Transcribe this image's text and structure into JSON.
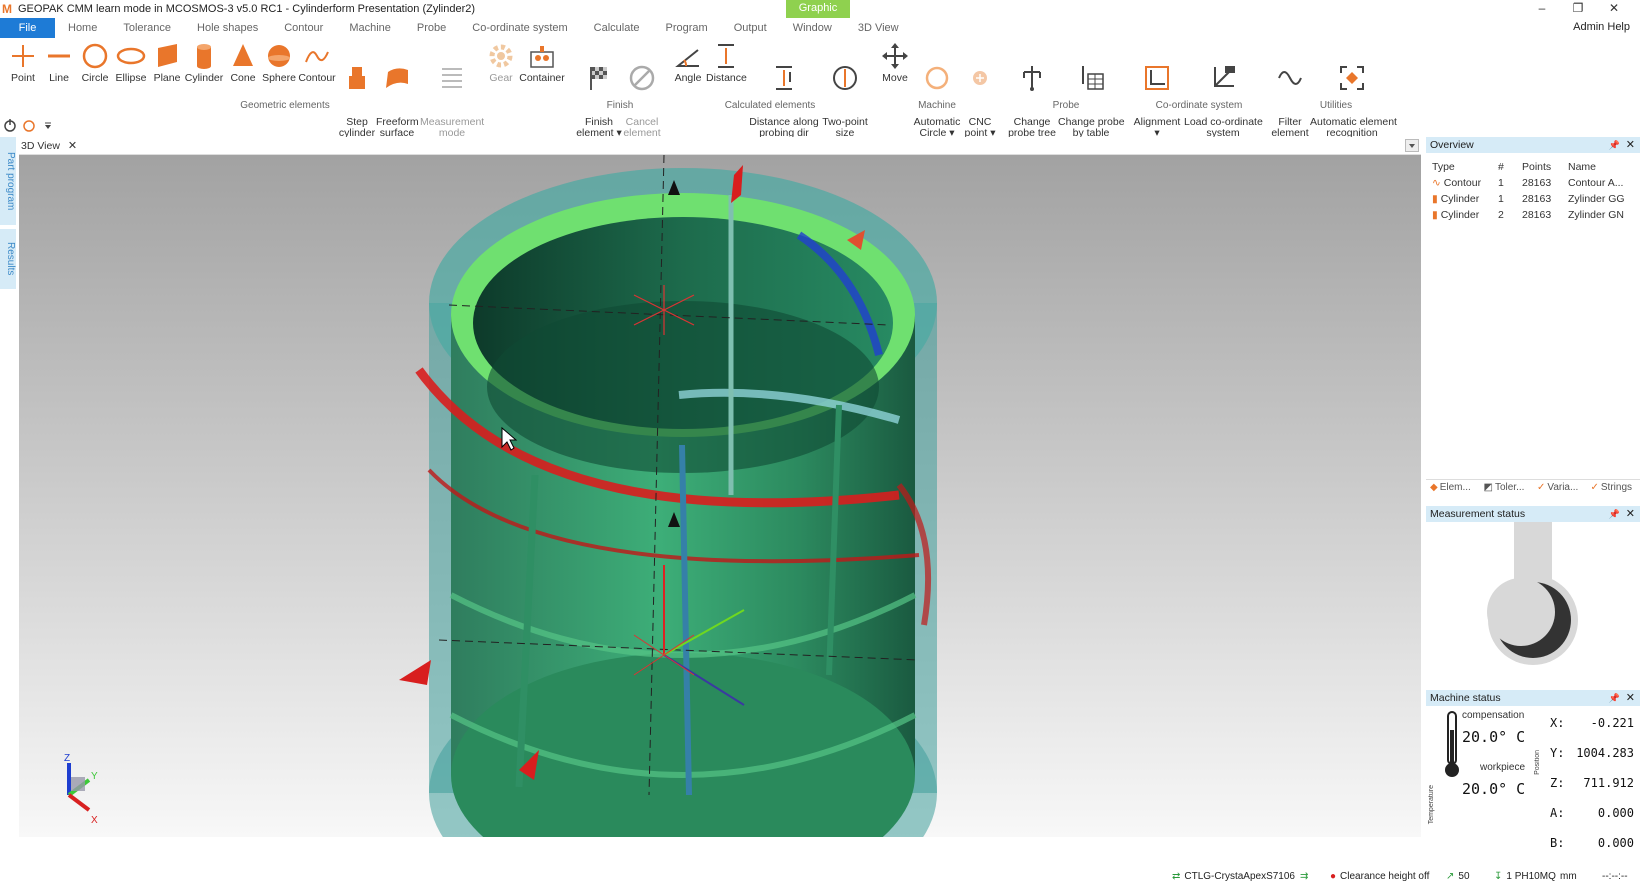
{
  "window": {
    "title": "GEOPAK CMM learn mode in MCOSMOS-3 v5.0 RC1  - Cylinderform Presentation (Zylinder2)",
    "logo": "M",
    "context_tab": "Graphic",
    "controls": [
      "–",
      "❐",
      "✕"
    ]
  },
  "menu": {
    "file": "File",
    "tabs": [
      "Home",
      "Tolerance",
      "Hole shapes",
      "Contour",
      "Machine",
      "Probe",
      "Co-ordinate system",
      "Calculate",
      "Program",
      "Output",
      "Window",
      "3D View"
    ],
    "user_admin": "Admin",
    "user_help": "Help"
  },
  "ribbon": {
    "buttons": [
      {
        "label": "Point",
        "icon": "point-icon"
      },
      {
        "label": "Line",
        "icon": "line-icon"
      },
      {
        "label": "Circle",
        "icon": "circle-icon"
      },
      {
        "label": "Ellipse",
        "icon": "ellipse-icon"
      },
      {
        "label": "Plane",
        "icon": "plane-icon"
      },
      {
        "label": "Cylinder",
        "icon": "cylinder-icon"
      },
      {
        "label": "Cone",
        "icon": "cone-icon"
      },
      {
        "label": "Sphere",
        "icon": "sphere-icon"
      },
      {
        "label": "Contour",
        "icon": "contour-icon"
      },
      {
        "label": "Step\ncylinder",
        "icon": "step-cylinder-icon"
      },
      {
        "label": "Freeform\nsurface",
        "icon": "freeform-surface-icon"
      },
      {
        "label": "Measurement\nmode",
        "icon": "measurement-mode-icon"
      },
      {
        "label": "Gear",
        "icon": "gear-icon"
      },
      {
        "label": "Container",
        "icon": "container-icon"
      },
      {
        "label": "Finish\nelement ▾",
        "icon": "finish-flag-icon"
      },
      {
        "label": "Cancel\nelement",
        "icon": "cancel-icon"
      },
      {
        "label": "Angle",
        "icon": "angle-icon"
      },
      {
        "label": "Distance",
        "icon": "distance-icon"
      },
      {
        "label": "Distance along\nprobing dir",
        "icon": "distance-probing-icon"
      },
      {
        "label": "Two-point\nsize",
        "icon": "two-point-size-icon"
      },
      {
        "label": "Move",
        "icon": "move-icon"
      },
      {
        "label": "Automatic\nCircle ▾",
        "icon": "automatic-circle-icon"
      },
      {
        "label": "CNC\npoint ▾",
        "icon": "cnc-point-icon"
      },
      {
        "label": "Change\nprobe tree",
        "icon": "probe-tree-icon"
      },
      {
        "label": "Change probe\nby table",
        "icon": "probe-table-icon"
      },
      {
        "label": "Alignment\n▾",
        "icon": "alignment-icon"
      },
      {
        "label": "Load co-ordinate\nsystem",
        "icon": "load-coordinate-system-icon"
      },
      {
        "label": "Filter\nelement",
        "icon": "filter-wave-icon"
      },
      {
        "label": "Automatic element\nrecognition",
        "icon": "auto-recognition-icon"
      }
    ],
    "groups": [
      "Geometric elements",
      "Finish",
      "Calculated elements",
      "Machine",
      "Probe",
      "Co-ordinate system",
      "Utilities"
    ]
  },
  "view": {
    "tab_label": "3D View",
    "close": "✕",
    "triad": {
      "z": "Z",
      "y": "Y",
      "x": "X"
    }
  },
  "left_dock": {
    "tabs": [
      "Part program",
      "Results"
    ]
  },
  "overview": {
    "title": "Overview",
    "columns": [
      "Type",
      "#",
      "Points",
      "Name"
    ],
    "rows": [
      {
        "type": "Contour",
        "num": "1",
        "points": "28163",
        "name": "Contour A..."
      },
      {
        "type": "Cylinder",
        "num": "1",
        "points": "28163",
        "name": "Zylinder GG"
      },
      {
        "type": "Cylinder",
        "num": "2",
        "points": "28163",
        "name": "Zylinder GN"
      }
    ],
    "bottom_tabs": [
      "Elem...",
      "Toler...",
      "Varia...",
      "Strings"
    ]
  },
  "measurement_status": {
    "title": "Measurement status"
  },
  "machine_status": {
    "title": "Machine status",
    "compensation_label": "compensation",
    "compensation_temp": "20.0° C",
    "workpiece_label": "workpiece",
    "workpiece_temp": "20.0° C",
    "temperature_label": "Temperature",
    "position_label": "Position",
    "coords": [
      {
        "axis": "X:",
        "value": "-0.221"
      },
      {
        "axis": "Y:",
        "value": "1004.283"
      },
      {
        "axis": "Z:",
        "value": "711.912"
      },
      {
        "axis": "A:",
        "value": "0.000"
      },
      {
        "axis": "B:",
        "value": "0.000"
      }
    ]
  },
  "statusbar": {
    "machine": "CTLG-CrystaApexS7106",
    "clearance": "Clearance height off",
    "speed": "50",
    "probe": "1 PH10MQ",
    "unit": "mm",
    "time": "--:--:--"
  },
  "colors": {
    "accent_orange": "#e9762b",
    "file_blue": "#1e7bd6",
    "graphic_green": "#8fd14f",
    "panel_header": "#d6ebf7"
  }
}
